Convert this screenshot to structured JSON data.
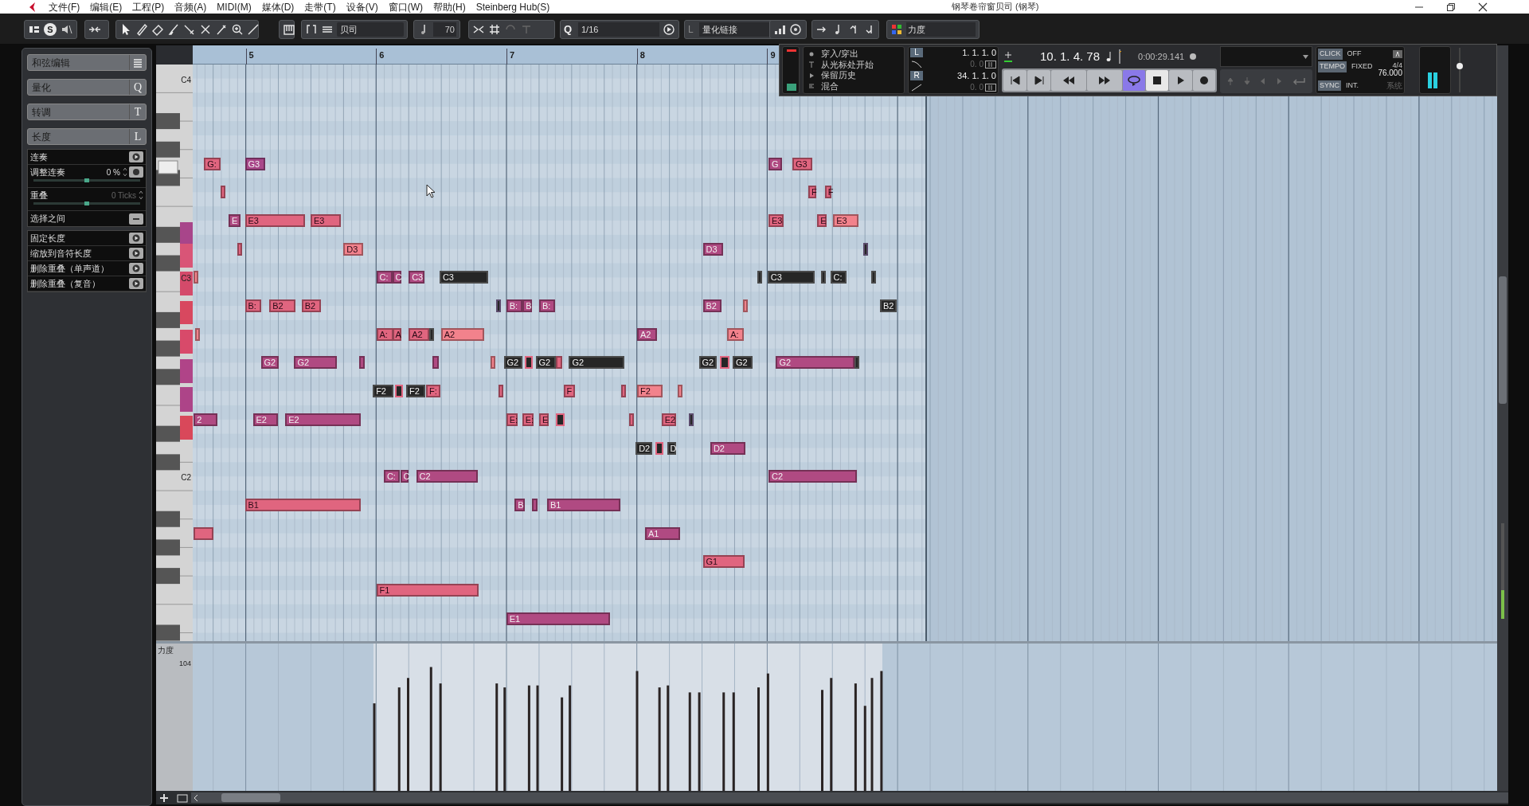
{
  "menu_bar": {
    "items": [
      "文件(F)",
      "编辑(E)",
      "工程(P)",
      "音频(A)",
      "MIDI(M)",
      "媒体(D)",
      "走带(T)",
      "设备(V)",
      "窗口(W)",
      "帮助(H)",
      "Steinberg Hub(S)"
    ]
  },
  "window": {
    "title": "钢琴卷帘窗贝司 (钢琴)"
  },
  "toolbar": {
    "solo_label": "S",
    "part_dropdown": "贝司",
    "velocity_value": "70",
    "quantize_label": "Q",
    "quantize_value": "1/16",
    "quantize_link": "量化链接",
    "link_label": "L",
    "controller_dropdown": "力度"
  },
  "inspector": {
    "sections": [
      {
        "label": "和弦编辑"
      },
      {
        "label": "量化",
        "shortcut": "Q"
      },
      {
        "label": "转调",
        "shortcut": "T"
      },
      {
        "label": "长度",
        "shortcut": "L"
      }
    ],
    "legato": [
      {
        "kind": "action",
        "label": "连奏"
      },
      {
        "kind": "slider",
        "label": "调整连奏",
        "value": "0 %",
        "level": 0.5,
        "disabled": false
      },
      {
        "kind": "slider",
        "label": "重叠",
        "value": "0 Ticks",
        "level": 0.5,
        "disabled": true
      },
      {
        "kind": "toggle",
        "label": "选择之间"
      }
    ],
    "length_actions": [
      "固定长度",
      "缩放到音符长度",
      "删除重叠（单声道）",
      "删除重叠（复音）"
    ]
  },
  "ruler": {
    "bars": [
      "5",
      "6",
      "7",
      "8",
      "9"
    ]
  },
  "keyboard": {
    "labels": [
      "C4",
      "C3",
      "C2"
    ]
  },
  "editor_zoom": {
    "level": 0.3
  },
  "notes": [
    {
      "label": "G:",
      "color": "#e0657f",
      "selected": false
    },
    {
      "label": "G3",
      "color": "#a9478a",
      "selected": false
    },
    {
      "label": "G",
      "color": "#b04a82",
      "selected": false
    },
    {
      "label": "G3",
      "color": "#e0657f",
      "selected": false
    },
    {
      "color": "#e0657f",
      "selected": false
    },
    {
      "label": "F",
      "color": "#e0657f",
      "selected": false
    },
    {
      "label": "F",
      "color": "#e0657f",
      "selected": false
    },
    {
      "label": "E",
      "color": "#b04a82",
      "selected": false
    },
    {
      "label": "E3",
      "color": "#e0657f",
      "selected": false
    },
    {
      "label": "E3",
      "color": "#e0657f",
      "selected": false
    },
    {
      "label": "E3",
      "color": "#e0657f",
      "selected": false
    },
    {
      "label": "E",
      "color": "#e0657f",
      "selected": false
    },
    {
      "label": "E3",
      "color": "#f2828c",
      "selected": false
    },
    {
      "color": "#e0657f",
      "selected": false
    },
    {
      "label": "D3",
      "color": "#f2828c",
      "selected": false
    },
    {
      "label": "D3",
      "color": "#b04a82",
      "selected": false
    },
    {
      "color": "#5a4a6a",
      "selected": true
    },
    {
      "color": "#f2828c",
      "selected": false
    },
    {
      "label": "C:",
      "color": "#b04a82",
      "selected": false
    },
    {
      "label": "C",
      "color": "#b04a82",
      "selected": false
    },
    {
      "label": "C3",
      "color": "#b04a82",
      "selected": false
    },
    {
      "label": "C3",
      "color": "#4a4a4a",
      "selected": true
    },
    {
      "color": "#4a4a4a",
      "selected": true
    },
    {
      "label": "C3",
      "color": "#4a4a4a",
      "selected": true
    },
    {
      "color": "#4a4a4a",
      "selected": true
    },
    {
      "label": "C:",
      "color": "#4a4a4a",
      "selected": true
    },
    {
      "color": "#4a4a4a",
      "selected": true
    },
    {
      "label": "B:",
      "color": "#e0657f",
      "selected": false
    },
    {
      "label": "B2",
      "color": "#e0657f",
      "selected": false
    },
    {
      "label": "B2",
      "color": "#e0657f",
      "selected": false
    },
    {
      "color": "#5a4a6a",
      "selected": true
    },
    {
      "label": "B:",
      "color": "#b04a82",
      "selected": false
    },
    {
      "label": "B",
      "color": "#b04a82",
      "selected": false
    },
    {
      "label": "B:",
      "color": "#b04a82",
      "selected": false
    },
    {
      "label": "B2",
      "color": "#b04a82",
      "selected": false
    },
    {
      "color": "#f2828c",
      "selected": false
    },
    {
      "label": "B2",
      "color": "#4a4a4a",
      "selected": true
    },
    {
      "color": "#f2828c",
      "selected": false
    },
    {
      "label": "A:",
      "color": "#e0657f",
      "selected": false
    },
    {
      "label": "A",
      "color": "#e0657f",
      "selected": false
    },
    {
      "label": "A2",
      "color": "#e0657f",
      "selected": false
    },
    {
      "color": "#4a4a4a",
      "selected": true
    },
    {
      "label": "A2",
      "color": "#f2828c",
      "selected": false
    },
    {
      "label": "A2",
      "color": "#b04a82",
      "selected": false
    },
    {
      "label": "A:",
      "color": "#f2828c",
      "selected": false
    },
    {
      "label": "G2",
      "color": "#b04a82",
      "selected": false
    },
    {
      "label": "G2",
      "color": "#b04a82",
      "selected": false
    },
    {
      "color": "#b04a82",
      "selected": false
    },
    {
      "color": "#b04a82",
      "selected": false
    },
    {
      "color": "#f2828c",
      "selected": false
    },
    {
      "label": "G2",
      "color": "#4a4a4a",
      "selected": true
    },
    {
      "color": "#e0657f",
      "selected": true
    },
    {
      "label": "G2",
      "color": "#4a4a4a",
      "selected": true
    },
    {
      "color": "#e0657f",
      "selected": false
    },
    {
      "label": "G2",
      "color": "#4a4a4a",
      "selected": true
    },
    {
      "label": "G2",
      "color": "#4a4a4a",
      "selected": true
    },
    {
      "color": "#e0657f",
      "selected": true
    },
    {
      "label": "G2",
      "color": "#4a4a4a",
      "selected": true
    },
    {
      "label": "G2",
      "color": "#b04a82",
      "selected": false
    },
    {
      "color": "#4a4a4a",
      "selected": true
    },
    {
      "label": "F2",
      "color": "#4a4a4a",
      "selected": true
    },
    {
      "color": "#e0657f",
      "selected": true
    },
    {
      "label": "F2",
      "color": "#4a4a4a",
      "selected": true
    },
    {
      "label": "F:",
      "color": "#e0657f",
      "selected": false
    },
    {
      "color": "#e0657f",
      "selected": false
    },
    {
      "label": "F",
      "color": "#e0657f",
      "selected": false
    },
    {
      "color": "#e0657f",
      "selected": false
    },
    {
      "label": "F2",
      "color": "#f2828c",
      "selected": false
    },
    {
      "color": "#f2828c",
      "selected": false
    },
    {
      "label": "2",
      "color": "#b04a82",
      "selected": false
    },
    {
      "label": "E2",
      "color": "#b04a82",
      "selected": false
    },
    {
      "label": "E2",
      "color": "#b04a82",
      "selected": false
    },
    {
      "label": "E:",
      "color": "#e0657f",
      "selected": false
    },
    {
      "label": "E:",
      "color": "#e0657f",
      "selected": false
    },
    {
      "label": "E",
      "color": "#e0657f",
      "selected": false
    },
    {
      "color": "#e0657f",
      "selected": true
    },
    {
      "color": "#e0657f",
      "selected": false
    },
    {
      "label": "E2",
      "color": "#e0657f",
      "selected": false
    },
    {
      "color": "#5a4a6a",
      "selected": true
    },
    {
      "label": "D2",
      "color": "#4a4a4a",
      "selected": true
    },
    {
      "color": "#e0657f",
      "selected": true
    },
    {
      "label": "D",
      "color": "#4a4a4a",
      "selected": true
    },
    {
      "label": "D2",
      "color": "#b04a82",
      "selected": false
    },
    {
      "label": "C:",
      "color": "#b04a82",
      "selected": false
    },
    {
      "label": "C",
      "color": "#b04a82",
      "selected": false
    },
    {
      "label": "C2",
      "color": "#b04a82",
      "selected": false
    },
    {
      "label": "C2",
      "color": "#b04a82",
      "selected": false
    },
    {
      "label": "B1",
      "color": "#e0657f",
      "selected": false
    },
    {
      "label": "B",
      "color": "#b04a82",
      "selected": false
    },
    {
      "color": "#b04a82",
      "selected": false
    },
    {
      "label": "B1",
      "color": "#b04a82",
      "selected": false
    },
    {
      "color": "#e0657f",
      "selected": false
    },
    {
      "label": "A1",
      "color": "#b04a82",
      "selected": false
    },
    {
      "label": "G1",
      "color": "#e0657f",
      "selected": false
    },
    {
      "label": "F1",
      "color": "#e0657f",
      "selected": false
    },
    {
      "label": "E1",
      "color": "#b04a82",
      "selected": false
    }
  ],
  "velocity_lane": {
    "title": "力度",
    "max": "104"
  },
  "transport": {
    "options": [
      "穿入/穿出",
      "从光标处开始",
      "保留历史",
      "混合"
    ],
    "left_locator": {
      "label": "L",
      "position": "1. 1. 1. 0",
      "offset": "0. 0"
    },
    "right_locator": {
      "label": "R",
      "position": "34. 1. 1. 0",
      "offset": "0. 0"
    },
    "position": "10. 1. 4. 78",
    "time": "0:00:29.141",
    "cycle": true,
    "click": {
      "label": "CLICK",
      "value": "OFF"
    },
    "tempo": {
      "label": "TEMPO",
      "mode": "FIXED",
      "signature": "4/4",
      "bpm": "76.000"
    },
    "sync": {
      "label": "SYNC",
      "value": "INT.",
      "source": "系统"
    },
    "master_volume": {
      "level": 0.6
    }
  }
}
